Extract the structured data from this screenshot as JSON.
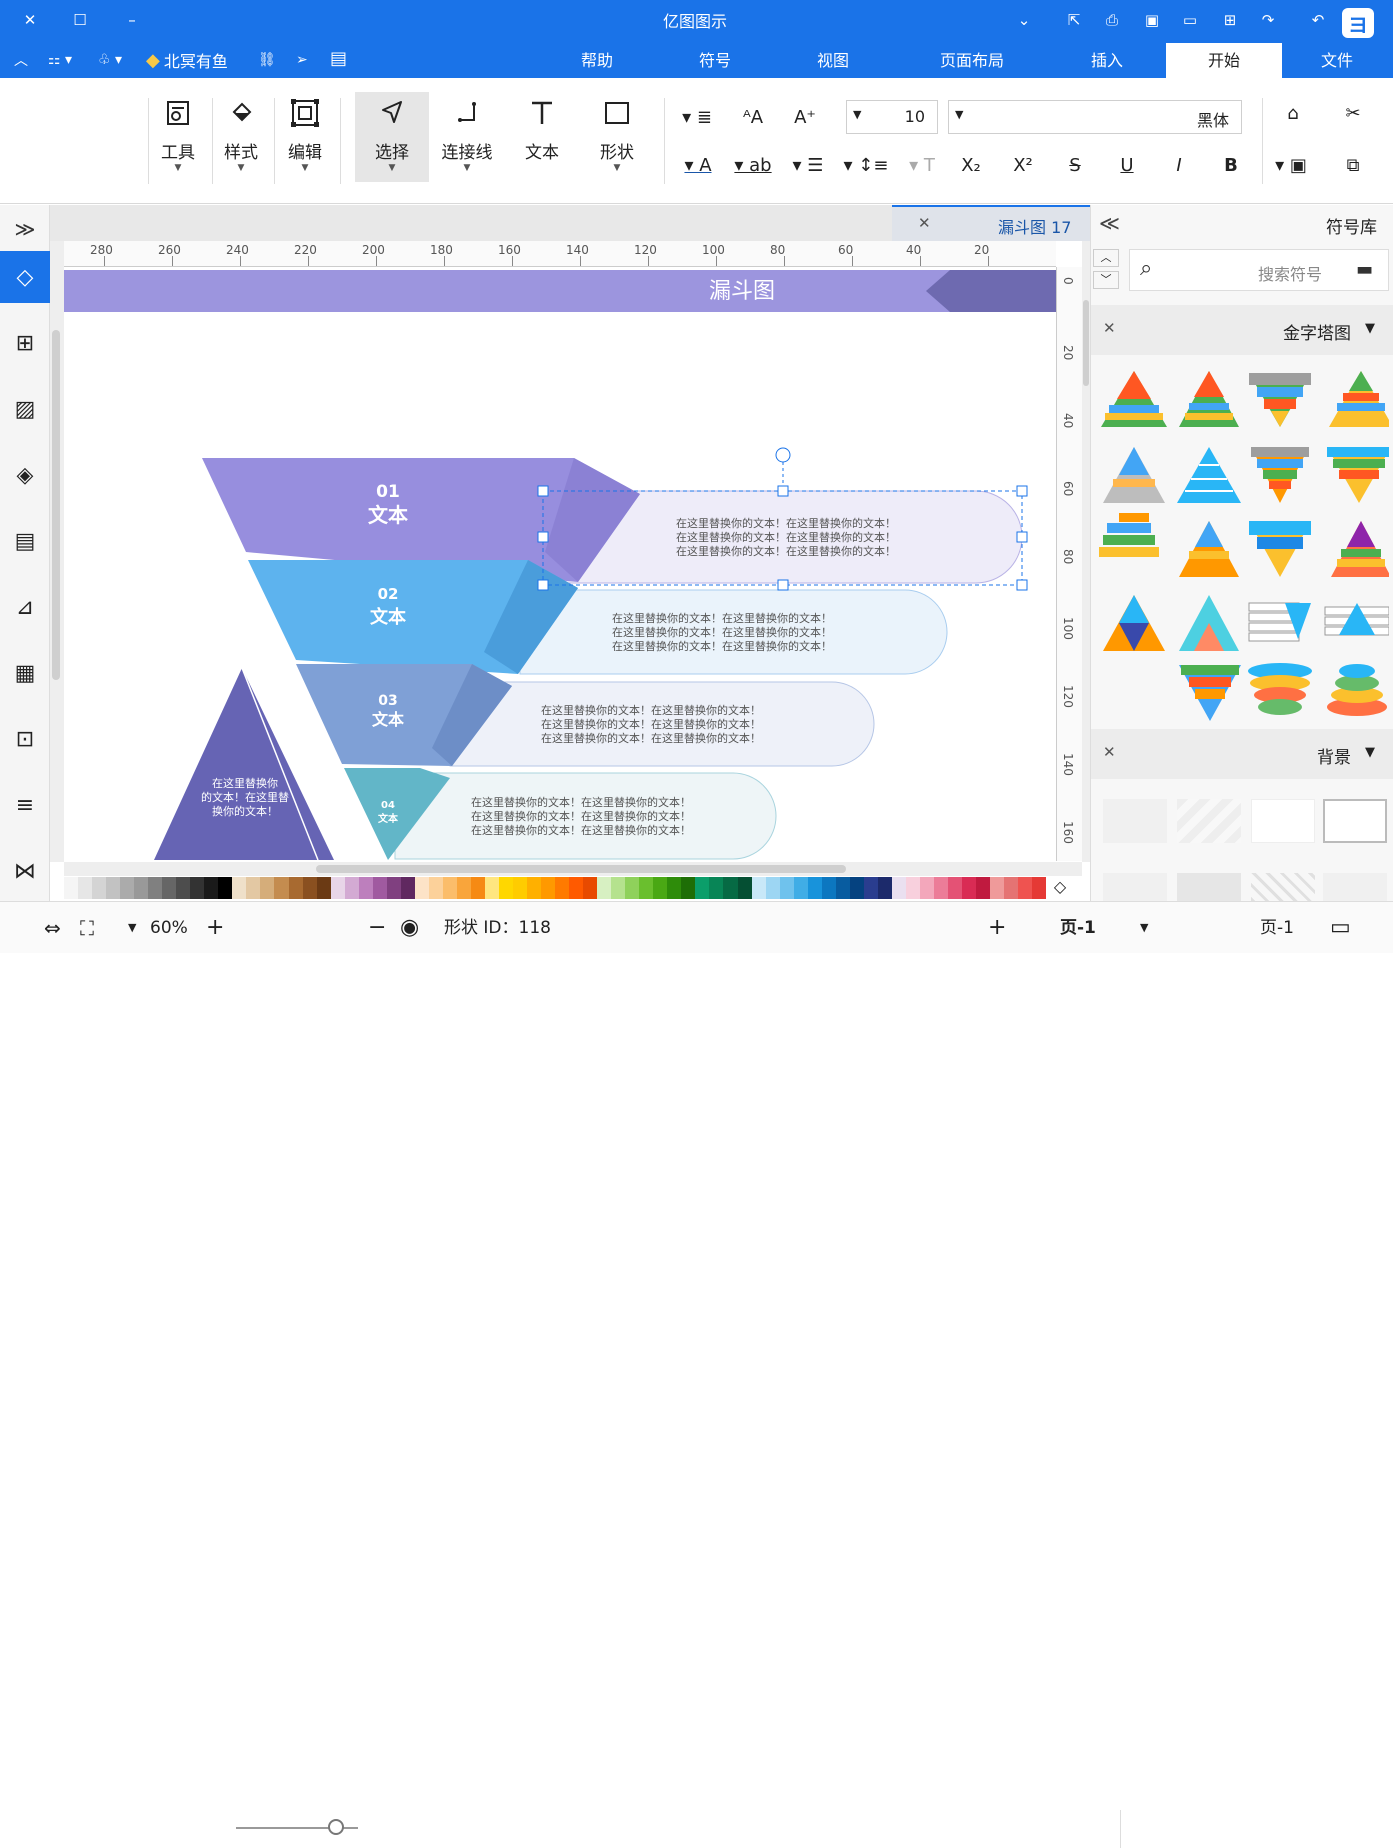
{
  "app": {
    "title": "亿图图示"
  },
  "menu": {
    "tabs": [
      "文件",
      "开始",
      "插入",
      "页面布局",
      "视图",
      "符号",
      "帮助"
    ],
    "active": "开始",
    "user": "北冥有鱼"
  },
  "ribbon": {
    "tools": [
      {
        "label": "工具",
        "icon": "tools-icon"
      },
      {
        "label": "样式",
        "icon": "paint-bucket-icon"
      },
      {
        "label": "编辑",
        "icon": "edit-frame-icon"
      },
      {
        "label": "选择",
        "icon": "cursor-icon"
      },
      {
        "label": "连接线",
        "icon": "connector-icon"
      },
      {
        "label": "文本",
        "icon": "text-icon"
      },
      {
        "label": "形状",
        "icon": "shape-icon"
      }
    ],
    "font_size": "10",
    "font_name": "黑体"
  },
  "document": {
    "tab_title": "漏斗图 17"
  },
  "ruler": {
    "h_ticks": [
      "280",
      "260",
      "240",
      "220",
      "200",
      "180",
      "160",
      "140",
      "120",
      "100",
      "80",
      "60",
      "40",
      "20"
    ],
    "v_ticks": [
      "0",
      "20",
      "40",
      "60",
      "80",
      "100",
      "120",
      "140",
      "160"
    ]
  },
  "diagram": {
    "banner": "漏斗图",
    "stages": [
      {
        "num": "01",
        "title": "文本",
        "body": [
          "在这里替换你的文本！在这里替换你的文本！",
          "在这里替换你的文本！在这里替换你的文本！",
          "在这里替换你的文本！在这里替换你的文本！"
        ],
        "color": "#978ede",
        "bubble": "#eeecf9"
      },
      {
        "num": "02",
        "title": "文本",
        "body": [
          "在这里替换你的文本！在这里替换你的文本！",
          "在这里替换你的文本！在这里替换你的文本！",
          "在这里替换你的文本！在这里替换你的文本！"
        ],
        "color": "#5aa9ea",
        "bubble": "#eaf3fb"
      },
      {
        "num": "03",
        "title": "文本",
        "body": [
          "在这里替换你的文本！在这里替换你的文本！",
          "在这里替换你的文本！在这里替换你的文本！",
          "在这里替换你的文本！在这里替换你的文本！"
        ],
        "color": "#7c9ed5",
        "bubble": "#eef1f9"
      },
      {
        "num": "04",
        "title": "文本",
        "body": [
          "在这里替换你的文本！在这里替换你的文本！",
          "在这里替换你的文本！在这里替换你的文本！",
          "在这里替换你的文本！在这里替换你的文本！"
        ],
        "color": "#62b6c8",
        "bubble": "#eef5f7"
      }
    ],
    "triangle_text": [
      "在这里替换你",
      "的文本！在这里替",
      "换你的文本！"
    ]
  },
  "library": {
    "title": "符号库",
    "search_placeholder": "搜索符号",
    "sections": [
      {
        "title": "金字塔图"
      },
      {
        "title": "背景"
      }
    ]
  },
  "status": {
    "page_tab": "页-1",
    "page_current": "页-1",
    "shape_id": "形状 ID：118",
    "zoom": "60%"
  },
  "palette": [
    "#f5f5f5",
    "#e6e6e6",
    "#d4d4d4",
    "#c2c2c2",
    "#ababab",
    "#999",
    "#808080",
    "#666",
    "#4d4d4d",
    "#333",
    "#1a1a1a",
    "#000",
    "#efe0c9",
    "#e3c8a3",
    "#d5ad7a",
    "#c48c4f",
    "#a86a30",
    "#8a5020",
    "#6b3a14",
    "#e8d5e8",
    "#d3aad3",
    "#bd7fbd",
    "#a05aa0",
    "#804080",
    "#602860",
    "#fde3c7",
    "#fcd19a",
    "#fbbd6a",
    "#f9a53b",
    "#f68a14",
    "#ffe680",
    "#ffd700",
    "#ffcc00",
    "#ffb000",
    "#ff9900",
    "#ff7a00",
    "#ff5a00",
    "#e84a00",
    "#d7f0c2",
    "#b5e28e",
    "#8fd15b",
    "#6abf2e",
    "#4aa814",
    "#2e8c0a",
    "#1e6e06",
    "#0b9e6a",
    "#088556",
    "#066a44",
    "#054f33",
    "#c8e8f8",
    "#9dd6f3",
    "#6fc2ed",
    "#40ade6",
    "#1893db",
    "#0c77c0",
    "#085ca0",
    "#054280",
    "#2a3d8f",
    "#1c2a6b",
    "#eae0f0",
    "#f8d0dd",
    "#f3a7bb",
    "#ec7c98",
    "#e45275",
    "#d92b54",
    "#c01a3f",
    "#ef9a9a",
    "#e57373",
    "#ef5350",
    "#e53935",
    "#c62828",
    "#b71c1c"
  ]
}
